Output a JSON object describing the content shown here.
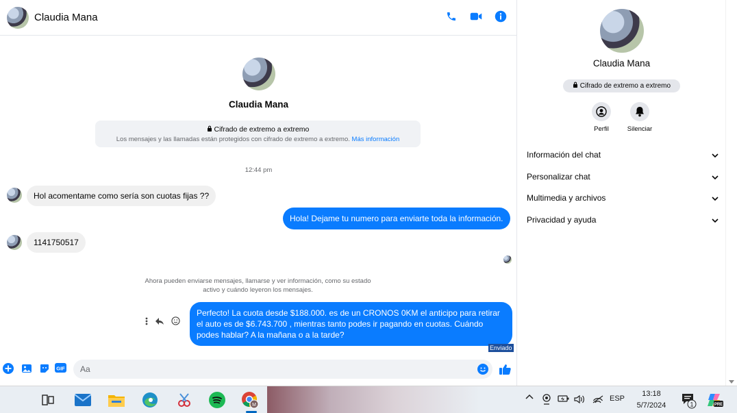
{
  "contact": {
    "name": "Claudia Mana"
  },
  "header": {
    "call_label": "phone",
    "video_label": "video",
    "info_label": "info"
  },
  "encryption": {
    "title": "Cifrado de extremo a extremo",
    "description": "Los mensajes y las llamadas están protegidos con cifrado de extremo a extremo.",
    "link": "Más información"
  },
  "timestamp": "12:44 pm",
  "messages": [
    {
      "direction": "in",
      "text": "Hol acomentame como sería son cuotas fijas ??"
    },
    {
      "direction": "out",
      "text": "Hola! Dejame tu numero  para enviarte toda la información."
    },
    {
      "direction": "in",
      "text": "1141750517"
    },
    {
      "direction": "out",
      "text": "Perfecto! La cuota desde $188.000. es de un CRONOS 0KM el anticipo para retirar el auto es de $6.743.700 , mientras tanto podes ir pagando en cuotas. Cuándo podes hablar? A la mañana o a la tarde?"
    }
  ],
  "system_note": "Ahora pueden enviarse mensajes, llamarse y ver información, como su estado activo y cuándo leyeron los mensajes.",
  "sent_status": "Enviado",
  "composer": {
    "placeholder": "Aa",
    "gif_label": "GIF"
  },
  "info_panel": {
    "encryption_badge": "Cifrado de extremo a extremo",
    "actions": [
      {
        "label": "Perfil",
        "icon": "profile-icon"
      },
      {
        "label": "Silenciar",
        "icon": "bell-icon"
      }
    ],
    "sections": [
      "Información del chat",
      "Personalizar chat",
      "Multimedia y archivos",
      "Privacidad y ayuda"
    ]
  },
  "taskbar": {
    "language": "ESP",
    "time": "13:18",
    "date": "5/7/2024",
    "notification_count": "1",
    "copilot_badge": "PRE",
    "chrome_badge": "M"
  },
  "colors": {
    "accent": "#0a7cff",
    "bubble_in": "#f0f0f0"
  }
}
